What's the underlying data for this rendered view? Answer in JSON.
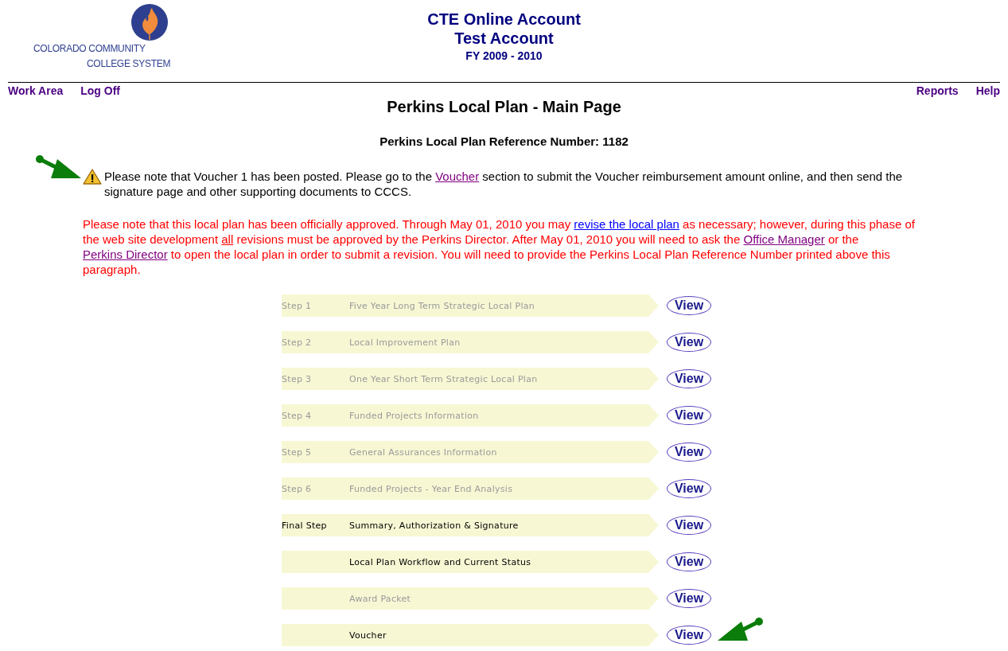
{
  "logo": {
    "lines": [
      "COLORADO COMMUNITY",
      "COLLEGE SYSTEM"
    ]
  },
  "header": {
    "title": "CTE Online Account",
    "subtitle": "Test Account",
    "fiscal_year": "FY 2009 - 2010"
  },
  "nav": {
    "left": [
      "Work Area",
      "Log Off"
    ],
    "right": [
      "Reports",
      "Help"
    ]
  },
  "page_title": "Perkins Local Plan - Main Page",
  "reference": "Perkins Local Plan Reference Number: 1182",
  "notice": [
    {
      "kind": "text",
      "text": "Please note that Voucher 1 has been posted. Please go to the "
    },
    {
      "kind": "link",
      "text": "Voucher",
      "visited": true
    },
    {
      "kind": "text",
      "text": " section to submit the Voucher reimbursement amount online, and then send the signature page and other supporting documents to CCCS."
    }
  ],
  "approval": [
    {
      "kind": "text",
      "text": "Please note that this local plan has been officially approved. Through May 01, 2010 you may "
    },
    {
      "kind": "link",
      "text": "revise the local plan",
      "visited": false
    },
    {
      "kind": "text",
      "text": " as necessary; however, during this phase of the web site development "
    },
    {
      "kind": "underline",
      "text": "all"
    },
    {
      "kind": "text",
      "text": " revisions must be approved by the Perkins Director. After May 01, 2010 you will need to ask the "
    },
    {
      "kind": "link",
      "text": "Office Manager",
      "visited": true
    },
    {
      "kind": "text",
      "text": " or the "
    },
    {
      "kind": "link",
      "text": "Perkins Director",
      "visited": true
    },
    {
      "kind": "text",
      "text": " to open the local plan in order to submit a revision. You will need to provide the Perkins Local Plan Reference Number printed above this paragraph."
    }
  ],
  "steps": [
    {
      "step": "Step 1",
      "title": "Five Year Long Term Strategic Local Plan",
      "disabled": true,
      "action": "View"
    },
    {
      "step": "Step 2",
      "title": "Local Improvement Plan",
      "disabled": true,
      "action": "View"
    },
    {
      "step": "Step 3",
      "title": "One Year Short Term Strategic Local Plan",
      "disabled": true,
      "action": "View"
    },
    {
      "step": "Step 4",
      "title": "Funded Projects Information",
      "disabled": true,
      "action": "View"
    },
    {
      "step": "Step 5",
      "title": "General Assurances Information",
      "disabled": true,
      "action": "View"
    },
    {
      "step": "Step 6",
      "title": "Funded Projects - Year End Analysis",
      "disabled": true,
      "action": "View"
    },
    {
      "step": "Final Step",
      "title": "Summary, Authorization & Signature",
      "disabled": false,
      "action": "View"
    },
    {
      "title": "Local Plan Workflow and Current Status",
      "disabled": false,
      "action": "View"
    },
    {
      "title": "Award Packet",
      "disabled": true,
      "action": "View"
    },
    {
      "title": "Voucher",
      "disabled": false,
      "action": "View",
      "pointer": true
    }
  ]
}
